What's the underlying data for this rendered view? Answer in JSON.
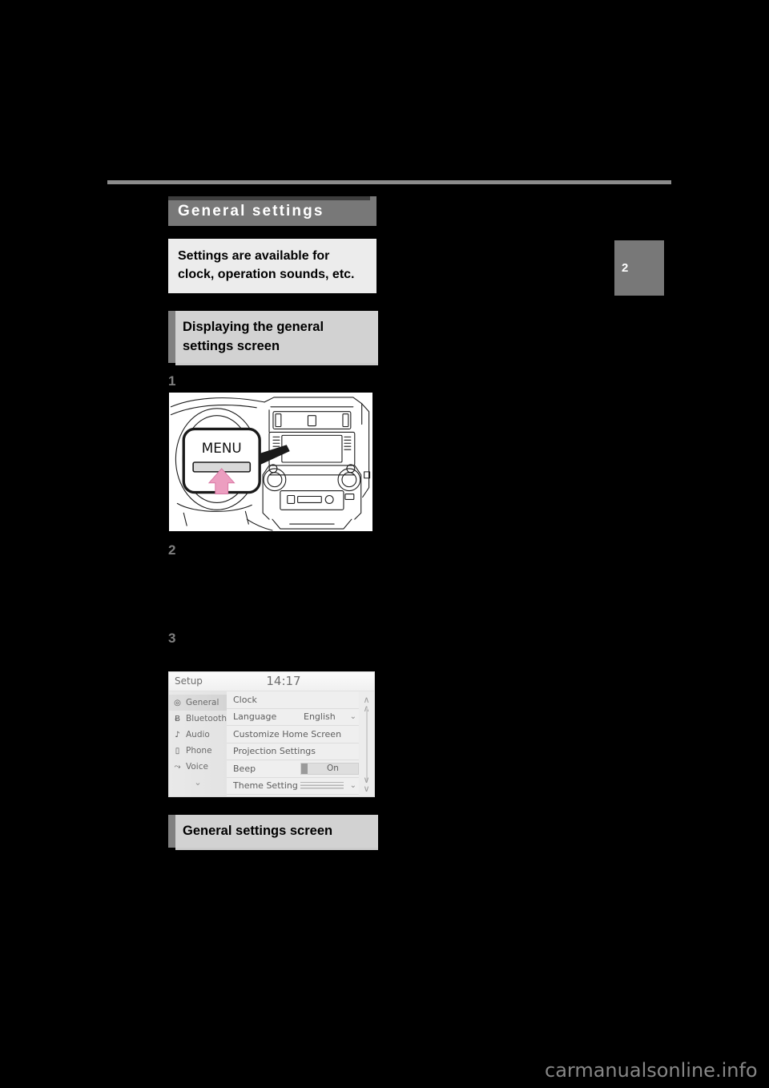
{
  "page": {
    "chapter_tab": "2",
    "watermark": "carmanualsonline.info"
  },
  "section": {
    "title": "General settings",
    "description": "Settings are available for clock, operation sounds, etc.",
    "subsection_heading": "Displaying the general settings screen",
    "screen_caption": "General settings screen"
  },
  "steps": {
    "one": "1",
    "two": "2",
    "three": "3"
  },
  "illustration": {
    "button_label": "MENU",
    "callout_color": "#ec9ec0"
  },
  "nav_screen": {
    "title": "Setup",
    "clock": "14:17",
    "sidebar": [
      {
        "label": "General",
        "icon": "target-icon",
        "glyph": "◎",
        "active": true
      },
      {
        "label": "Bluetooth",
        "icon": "bluetooth-icon",
        "glyph": "Ƀ",
        "active": false
      },
      {
        "label": "Audio",
        "icon": "music-note-icon",
        "glyph": "♪",
        "active": false
      },
      {
        "label": "Phone",
        "icon": "phone-icon",
        "glyph": "▯",
        "active": false
      },
      {
        "label": "Voice",
        "icon": "voice-icon",
        "glyph": "⤳",
        "active": false
      }
    ],
    "sidebar_more_glyph": "⌄",
    "rows": [
      {
        "label": "Clock",
        "value": "",
        "control": "none"
      },
      {
        "label": "Language",
        "value": "English",
        "control": "chevron"
      },
      {
        "label": "Customize Home Screen",
        "value": "",
        "control": "none"
      },
      {
        "label": "Projection Settings",
        "value": "",
        "control": "none"
      },
      {
        "label": "Beep",
        "value": "On",
        "control": "toggle"
      },
      {
        "label": "Theme Setting",
        "value": "",
        "control": "swatch-chevron"
      }
    ],
    "scroll_up_glyph": "«",
    "scroll_down_glyph": "»"
  },
  "colors": {
    "page_bg": "#000000",
    "title_bar": "#787878",
    "desc_bg": "#ececec",
    "subhead_bg": "#d2d2d2",
    "step_num": "#808080",
    "rule": "#8c8c8c"
  }
}
